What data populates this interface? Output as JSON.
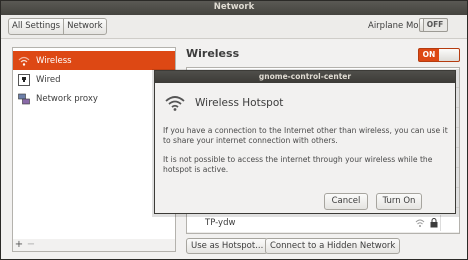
{
  "window": {
    "title": "Network"
  },
  "toolbar": {
    "breadcrumbs": [
      "All Settings",
      "Network"
    ],
    "airplane_label": "Airplane Mode",
    "airplane_state": "OFF"
  },
  "sidebar": {
    "items": [
      {
        "label": "Wireless",
        "icon": "wifi-icon",
        "selected": true
      },
      {
        "label": "Wired",
        "icon": "ethernet-icon",
        "selected": false
      },
      {
        "label": "Network proxy",
        "icon": "proxy-icon",
        "selected": false
      }
    ],
    "add_label": "+",
    "remove_label": "−"
  },
  "main": {
    "title": "Wireless",
    "switch_state": "ON",
    "networks": [
      {
        "ssid": "",
        "secured": true,
        "details": false
      },
      {
        "ssid": "",
        "secured": true,
        "details": true
      },
      {
        "ssid": "",
        "secured": true,
        "details": false
      },
      {
        "ssid": "",
        "secured": true,
        "details": true
      },
      {
        "ssid": "",
        "secured": true,
        "details": false
      },
      {
        "ssid": "",
        "secured": true,
        "details": true
      },
      {
        "ssid": "",
        "secured": true,
        "details": false
      },
      {
        "ssid": "TP-ydw",
        "secured": true,
        "details": false
      }
    ],
    "hotspot_button": "Use as Hotspot...",
    "hidden_button": "Connect to a Hidden Network"
  },
  "dialog": {
    "title": "gnome-control-center",
    "heading": "Wireless Hotspot",
    "body1": "If you have a connection to the Internet other than wireless, you can use it to share your internet connection with others.",
    "body2": "It is not possible to access the internet through your wireless while the hotspot is active.",
    "cancel_label": "Cancel",
    "turn_on_label": "Turn On"
  },
  "colors": {
    "accent": "#dd4814",
    "titlebar": "#45443f",
    "background": "#f2f1f0"
  }
}
